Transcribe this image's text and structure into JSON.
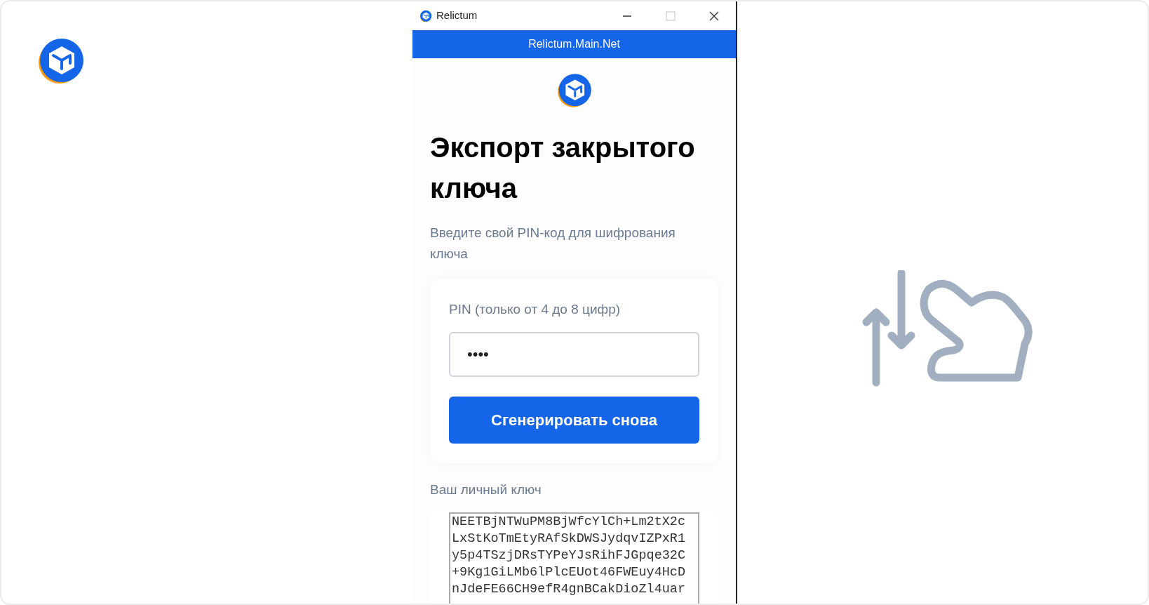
{
  "window": {
    "title": "Relictum"
  },
  "network_bar": {
    "label": "Relictum.Main.Net"
  },
  "heading": "Экспорт закрытого ключа",
  "subtitle": "Введите свой PIN-код для шифрования ключа",
  "pin_card": {
    "label": "PIN (только от 4 до 8 цифр)",
    "value": "••••",
    "button": "Сгенерировать снова"
  },
  "key_section": {
    "label": "Ваш личный ключ",
    "key_lines": [
      "NEETBjNTWuPM8BjWfcYlCh+Lm2tX2c",
      "LxStKoTmEtyRAfSkDWSJydqvIZPxR1",
      "y5p4TSzjDRsTYPeYJsRihFJGpqe32C",
      "+9Kg1GiLMb6lPlcEUot46FWEuy4HcD",
      "nJdeFE66CH9efR4gnBCakDioZl4uar"
    ]
  }
}
